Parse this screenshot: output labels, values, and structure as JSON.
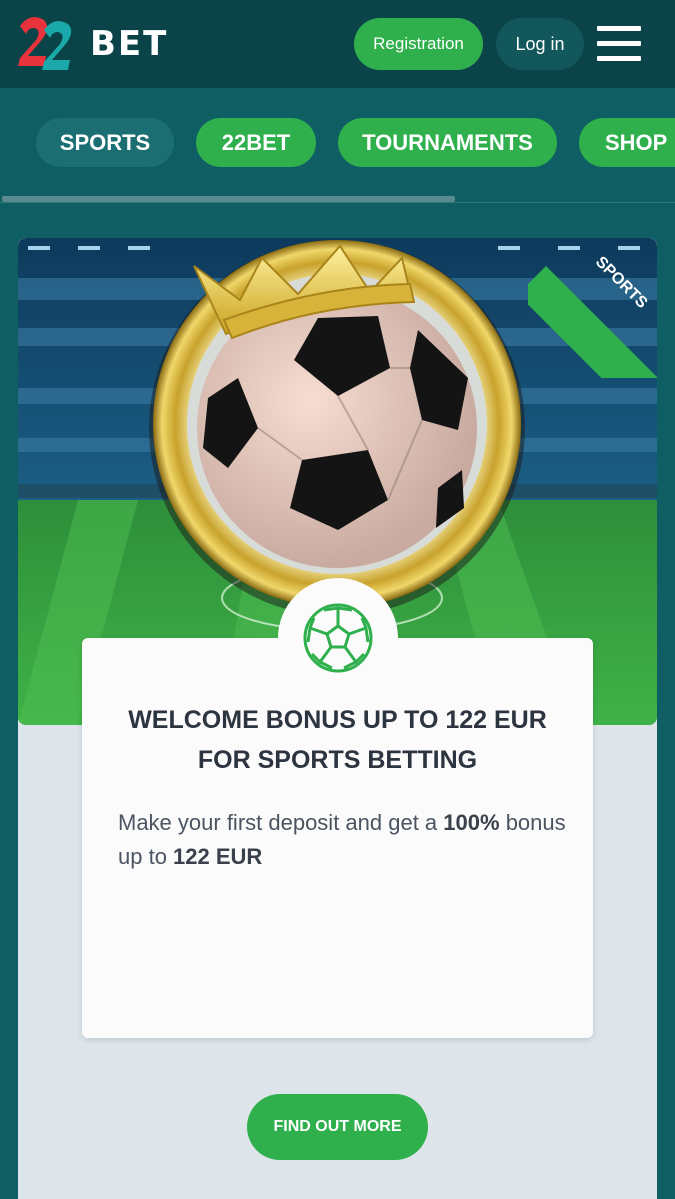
{
  "header": {
    "logo_numbers": "22",
    "logo_text": "BET",
    "registration_label": "Registration",
    "login_label": "Log in",
    "menu_icon": "hamburger-menu-icon"
  },
  "tabs": [
    {
      "label": "SPORTS",
      "active": true
    },
    {
      "label": "22BET",
      "active": false
    },
    {
      "label": "TOURNAMENTS",
      "active": false
    },
    {
      "label": "SHOP",
      "active": false
    }
  ],
  "promo": {
    "ribbon": "SPORTS",
    "badge_icon": "soccer-ball-icon",
    "title": "WELCOME BONUS UP TO 122 EUR FOR SPORTS BETTING",
    "text_part1": "Make your first deposit and get a ",
    "text_bold1": "100%",
    "text_part2": " bonus up to ",
    "text_bold2": "122 EUR",
    "cta_label": "FIND OUT MORE"
  },
  "colors": {
    "header_bg": "#0a4348",
    "page_bg": "#0e5e63",
    "accent_green": "#2fb04d",
    "logo_red": "#e8323c",
    "logo_teal": "#1aa8a8"
  }
}
